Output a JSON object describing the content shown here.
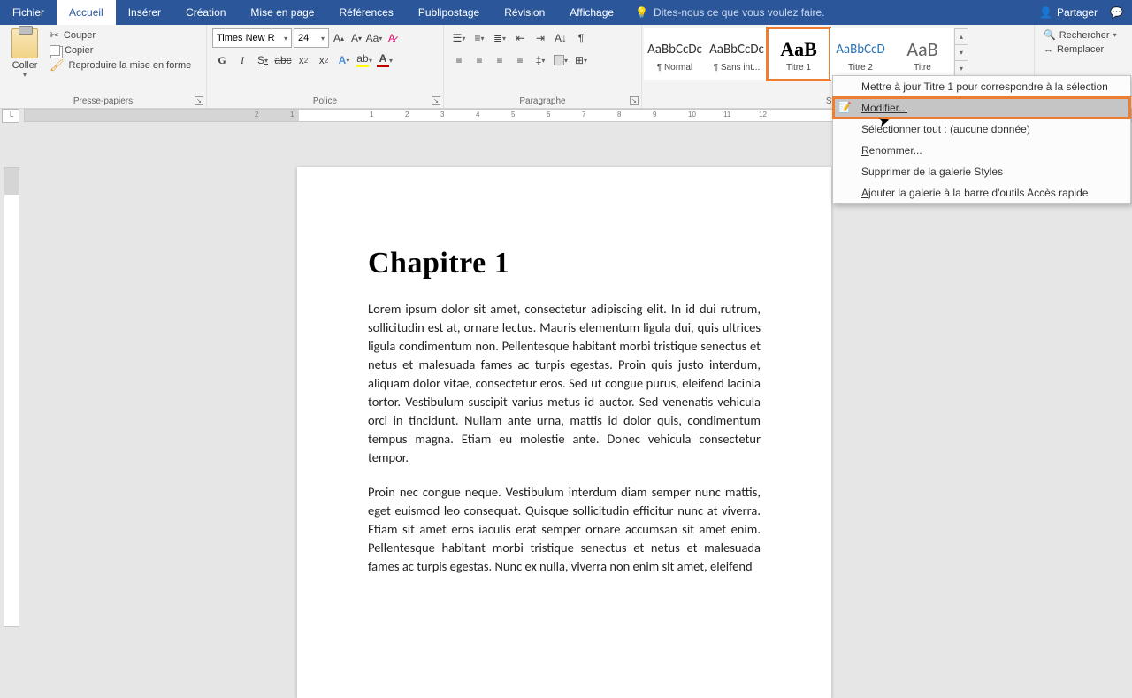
{
  "titlebar": {
    "tabs": {
      "file": "Fichier",
      "home": "Accueil",
      "insert": "Insérer",
      "design": "Création",
      "layout": "Mise en page",
      "references": "Références",
      "mailings": "Publipostage",
      "review": "Révision",
      "view": "Affichage"
    },
    "tellme": "Dites-nous ce que vous voulez faire.",
    "share": "Partager"
  },
  "ribbon": {
    "clipboard": {
      "paste": "Coller",
      "cut": "Couper",
      "copy": "Copier",
      "format_painter": "Reproduire la mise en forme",
      "label": "Presse-papiers"
    },
    "font": {
      "name": "Times New R",
      "size": "24",
      "label": "Police",
      "bold": "G",
      "italic": "I",
      "underline": "S",
      "strike": "abc"
    },
    "paragraph": {
      "label": "Paragraphe"
    },
    "styles": {
      "label": "Styles",
      "tiles": [
        {
          "preview": "AaBbCcDc",
          "label": "¶ Normal"
        },
        {
          "preview": "AaBbCcDc",
          "label": "¶ Sans int..."
        },
        {
          "preview": "AaB",
          "label": "Titre 1"
        },
        {
          "preview": "AaBbCcD",
          "label": "Titre 2"
        },
        {
          "preview": "AaB",
          "label": "Titre"
        }
      ]
    },
    "editing": {
      "find": "Rechercher",
      "replace": "Remplacer"
    }
  },
  "context_menu": {
    "update": "Mettre à jour Titre 1 pour correspondre à la sélection",
    "modify": "Modifier...",
    "select_all_pre": "S",
    "select_all_rest": "électionner tout : (aucune donnée)",
    "rename_pre": "R",
    "rename_rest": "enommer...",
    "remove": "Supprimer de la galerie Styles",
    "add_qat_pre": "A",
    "add_qat_rest": "jouter la galerie à la barre d'outils Accès rapide"
  },
  "document": {
    "heading": "Chapitre 1",
    "para1": "Lorem ipsum dolor sit amet, consectetur adipiscing elit. In id dui rutrum, sollicitudin est at, ornare lectus. Mauris elementum ligula dui, quis ultrices ligula condimentum non. Pellentesque habitant morbi tristique senectus et netus et malesuada fames ac turpis egestas. Proin quis justo interdum, aliquam dolor vitae, consectetur eros. Sed ut congue purus, eleifend lacinia tortor. Vestibulum suscipit varius metus id auctor. Sed venenatis vehicula orci in tincidunt. Nullam ante urna, mattis id dolor quis, condimentum tempus magna. Etiam eu molestie ante. Donec vehicula consectetur tempor.",
    "para2": "Proin nec congue neque. Vestibulum interdum diam semper nunc mattis, eget euismod leo consequat. Quisque sollicitudin efficitur nunc at viverra. Etiam sit amet eros iaculis erat semper ornare accumsan sit amet enim. Pellentesque habitant morbi tristique senectus et netus et malesuada fames ac turpis egestas. Nunc ex nulla, viverra non enim sit amet, eleifend"
  },
  "ruler": {
    "tabstop": "└"
  }
}
